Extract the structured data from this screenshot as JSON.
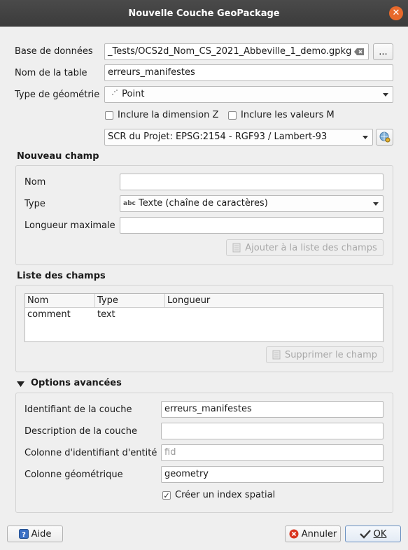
{
  "window": {
    "title": "Nouvelle Couche GeoPackage",
    "close_symbol": "✕"
  },
  "form": {
    "database_label": "Base de données",
    "database_value": "_Tests/OCS2d_Nom_CS_2021_Abbeville_1_demo.gpkg",
    "browse_label": "...",
    "table_label": "Nom de la table",
    "table_value": "erreurs_manifestes",
    "geometry_label": "Type de géométrie",
    "geometry_value": "Point",
    "include_z_label": "Inclure la dimension Z",
    "include_m_label": "Inclure les valeurs M",
    "crs_value": "SCR du Projet: EPSG:2154 - RGF93 / Lambert-93"
  },
  "new_field": {
    "title": "Nouveau champ",
    "name_label": "Nom",
    "name_value": "",
    "type_label": "Type",
    "type_icon_text": "abc",
    "type_value": "Texte (chaîne de caractères)",
    "maxlen_label": "Longueur maximale",
    "maxlen_value": "",
    "add_button": "Ajouter à la liste des champs"
  },
  "field_list": {
    "title": "Liste des champs",
    "columns": [
      "Nom",
      "Type",
      "Longueur"
    ],
    "rows": [
      {
        "name": "comment",
        "type": "text",
        "length": ""
      }
    ],
    "remove_button": "Supprimer le champ"
  },
  "advanced": {
    "title": "Options avancées",
    "layer_id_label": "Identifiant de la couche",
    "layer_id_value": "erreurs_manifestes",
    "layer_desc_label": "Description de la couche",
    "layer_desc_value": "",
    "fid_label": "Colonne d'identifiant d'entité",
    "fid_placeholder": "fid",
    "geom_col_label": "Colonne géométrique",
    "geom_col_value": "geometry",
    "spatial_index_label": "Créer un index spatial",
    "spatial_index_checked": true
  },
  "footer": {
    "help_button": "Aide",
    "cancel_button": "Annuler",
    "ok_button": "OK"
  },
  "colors": {
    "titlebar": "#3f3f3f",
    "close": "#e8692b",
    "background": "#efefef"
  }
}
